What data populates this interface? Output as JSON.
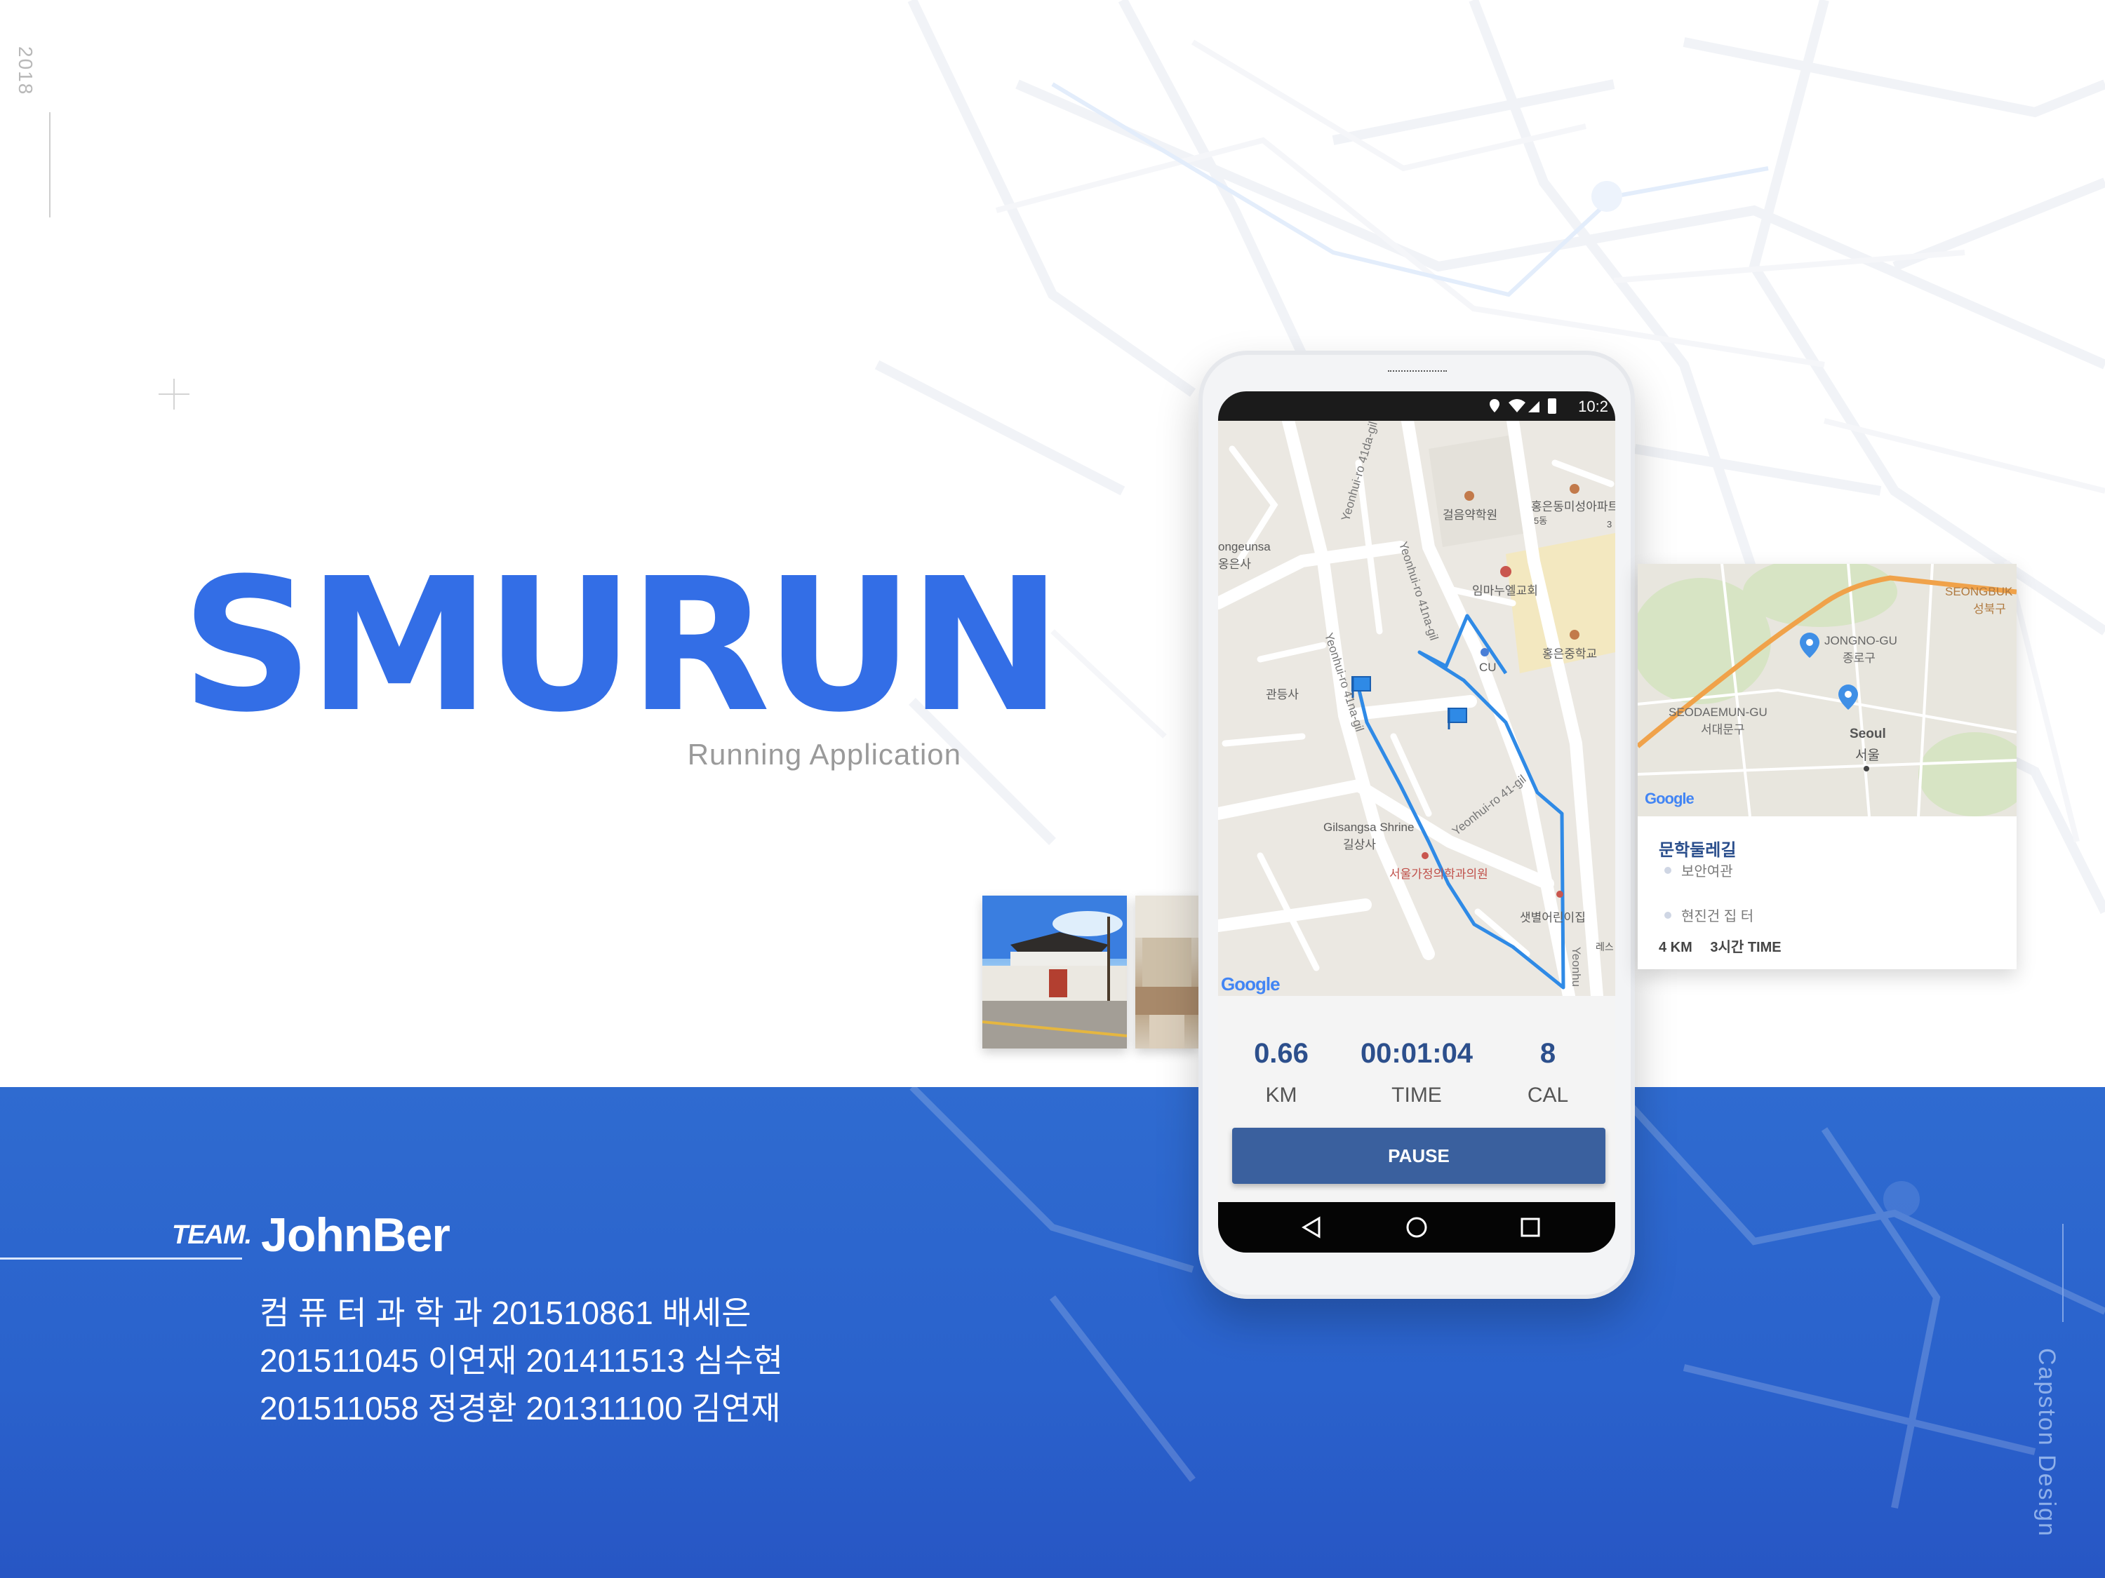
{
  "year": "2018",
  "title": "SMURUN",
  "subtitle": "Running Application",
  "team": {
    "label": "TEAM.",
    "name": "JohnBer",
    "members": [
      "컴 퓨 터 과 학 과 201510861 배세은",
      "201511045 이연재  201411513 심수현",
      "201511058 정경환  201311100 김연재"
    ]
  },
  "footer_vertical": "Capston Design",
  "phone": {
    "status_time": "10:2",
    "map_labels": {
      "yeonhui_41da": "Yeonhui-ro 41da-gil",
      "yeonhui_41na": "Yeonhui-ro 41na-gil",
      "yeonhui_41na_2": "Yeonhui-ro 41na-gil",
      "yeonhui_41": "Yeonhui-ro 41-gil",
      "yeonhui": "Yeonhu",
      "pharmacy": "걸음약학원",
      "apt": "홍은동미성아파트",
      "apt_sub": "5동",
      "apt_sub2": "3",
      "church": "임마누엘교회",
      "school": "홍은중학교",
      "cu": "CU",
      "temple1": "ongeunsa",
      "temple1_kr": "옹은사",
      "temple2": "관등사",
      "gilsangsa": "Gilsangsa Shrine",
      "gilsangsa_kr": "길상사",
      "clinic": "서울가정의학과의원",
      "shop": "샛별어린이집",
      "shop2": "레스"
    },
    "google": "Google",
    "stats": [
      {
        "value": "0.66",
        "label": "KM"
      },
      {
        "value": "00:01:04",
        "label": "TIME"
      },
      {
        "value": "8",
        "label": "CAL"
      }
    ],
    "pause_label": "PAUSE"
  },
  "card": {
    "map_labels": {
      "seongbuk": "SEONGBUK",
      "seongbuk_kr": "성북구",
      "jongno": "JONGNO-GU",
      "jongno_kr": "종로구",
      "seodaemun": "SEODAEMUN-GU",
      "seodaemun_kr": "서대문구",
      "seoul": "Seoul",
      "seoul_kr": "서울"
    },
    "google": "Google",
    "title": "문학둘레길",
    "stops": [
      "보안여관",
      "현진건 집 터"
    ],
    "distance": "4 KM",
    "time": "3시간 TIME"
  },
  "colors": {
    "brand": "#336ee6",
    "band": "#2a62cc",
    "route": "#2f8ae6",
    "button": "#3a609e",
    "stat_value": "#2c4f8c"
  }
}
